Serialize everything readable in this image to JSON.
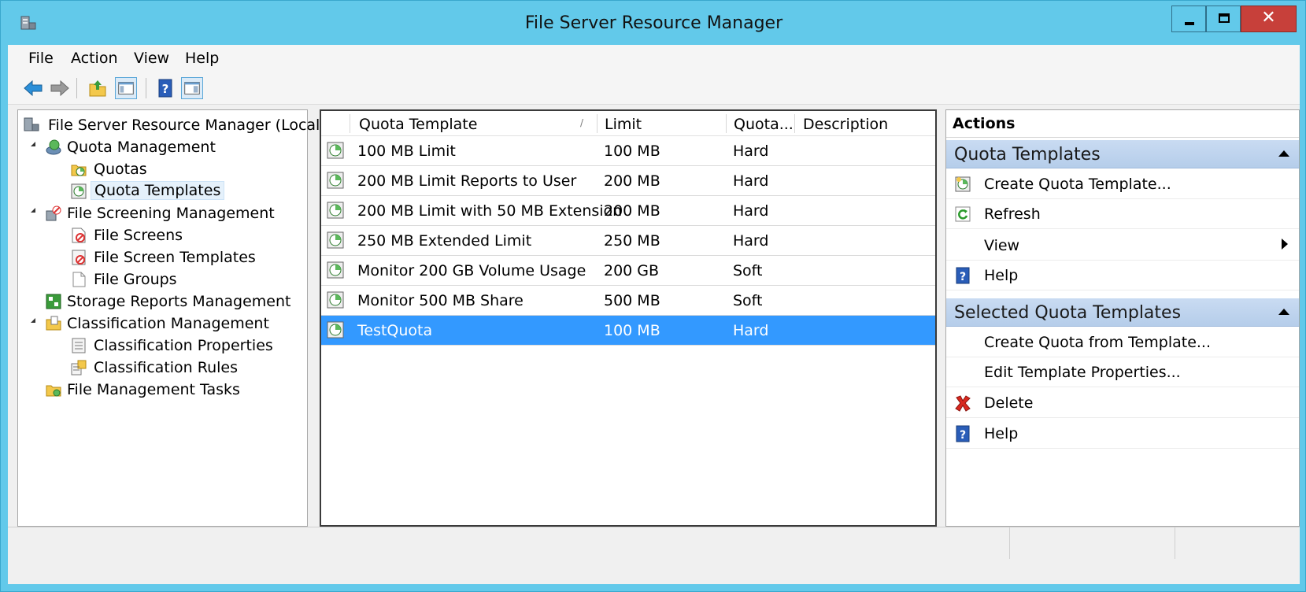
{
  "window": {
    "title": "File Server Resource Manager"
  },
  "menu": [
    "File",
    "Action",
    "View",
    "Help"
  ],
  "toolbar": {
    "icons": [
      "back-icon",
      "forward-icon",
      "up-folder-icon",
      "show-hide-tree-icon",
      "help-icon",
      "show-hide-action-pane-icon"
    ]
  },
  "tree": {
    "root": "File Server Resource Manager (Local)",
    "items": [
      "Quota Management",
      "Quotas",
      "Quota Templates",
      "File Screening Management",
      "File Screens",
      "File Screen Templates",
      "File Groups",
      "Storage Reports Management",
      "Classification Management",
      "Classification Properties",
      "Classification Rules",
      "File Management Tasks"
    ],
    "selected": "Quota Templates"
  },
  "list": {
    "columns": [
      "Quota Template",
      "Limit",
      "Quota...",
      "Description"
    ],
    "rows": [
      {
        "name": "100 MB Limit",
        "limit": "100 MB",
        "type": "Hard",
        "description": ""
      },
      {
        "name": "200 MB Limit Reports to User",
        "limit": "200 MB",
        "type": "Hard",
        "description": ""
      },
      {
        "name": "200 MB Limit with 50 MB Extension",
        "limit": "200 MB",
        "type": "Hard",
        "description": ""
      },
      {
        "name": "250 MB Extended Limit",
        "limit": "250 MB",
        "type": "Hard",
        "description": ""
      },
      {
        "name": "Monitor 200 GB Volume Usage",
        "limit": "200 GB",
        "type": "Soft",
        "description": ""
      },
      {
        "name": "Monitor 500 MB Share",
        "limit": "500 MB",
        "type": "Soft",
        "description": ""
      },
      {
        "name": "TestQuota",
        "limit": "100 MB",
        "type": "Hard",
        "description": ""
      }
    ],
    "selected_row": "TestQuota"
  },
  "actions": {
    "header": "Actions",
    "section1": {
      "title": "Quota Templates",
      "items": [
        "Create Quota Template...",
        "Refresh",
        "View",
        "Help"
      ]
    },
    "section2": {
      "title": "Selected Quota Templates",
      "items": [
        "Create Quota from Template...",
        "Edit Template Properties...",
        "Delete",
        "Help"
      ]
    }
  },
  "colors": {
    "titlebar": "#62c9ea",
    "selection": "#3399ff",
    "close_button": "#c7403a"
  }
}
